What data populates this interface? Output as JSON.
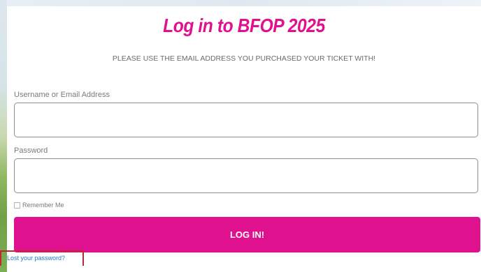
{
  "login": {
    "title": "Log in to BFOP 2025",
    "subtitle": "PLEASE USE THE EMAIL ADDRESS YOU PURCHASED YOUR TICKET WITH!",
    "username_label": "Username or Email Address",
    "username_value": "",
    "password_label": "Password",
    "password_value": "",
    "remember_label": "Remember Me",
    "remember_checked": false,
    "submit_label": "LOG IN!",
    "lost_password_label": "Lost your password?"
  },
  "colors": {
    "accent": "#e0118f",
    "link": "#2a74c7",
    "highlight_border": "#c0262d"
  }
}
